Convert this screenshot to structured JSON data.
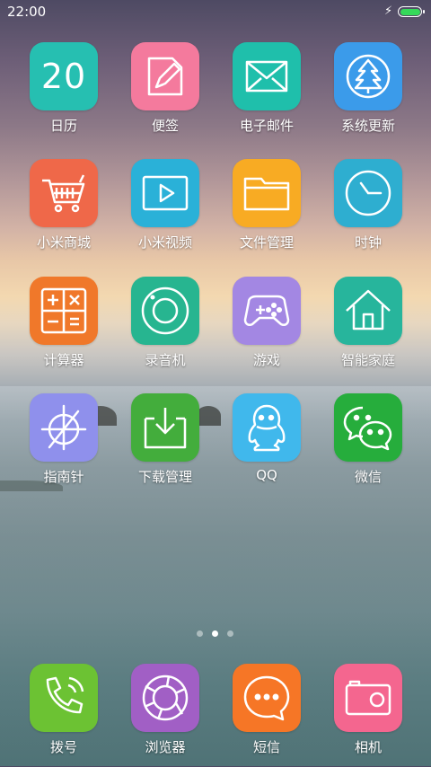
{
  "status": {
    "time": "22:00",
    "battery_level": 1.0,
    "charging": true
  },
  "pages": {
    "count": 3,
    "active": 2
  },
  "apps": [
    {
      "label": "日历",
      "icon": "calendar-icon",
      "color": "#26bfb1",
      "day": "20"
    },
    {
      "label": "便签",
      "icon": "notes-icon",
      "color": "#f47a9d"
    },
    {
      "label": "电子邮件",
      "icon": "mail-icon",
      "color": "#1fbfab"
    },
    {
      "label": "系统更新",
      "icon": "tree-update-icon",
      "color": "#3b9bea"
    },
    {
      "label": "小米商城",
      "icon": "cart-icon",
      "color": "#ef6849"
    },
    {
      "label": "小米视频",
      "icon": "video-play-icon",
      "color": "#2ab1d8"
    },
    {
      "label": "文件管理",
      "icon": "folder-icon",
      "color": "#f8ab23"
    },
    {
      "label": "时钟",
      "icon": "clock-icon",
      "color": "#2eaed0"
    },
    {
      "label": "计算器",
      "icon": "calculator-icon",
      "color": "#f0782a"
    },
    {
      "label": "录音机",
      "icon": "recorder-icon",
      "color": "#27b590"
    },
    {
      "label": "游戏",
      "icon": "gamepad-icon",
      "color": "#a387e3"
    },
    {
      "label": "智能家庭",
      "icon": "home-icon",
      "color": "#27b59c"
    },
    {
      "label": "指南针",
      "icon": "compass-icon",
      "color": "#8f90ec"
    },
    {
      "label": "下载管理",
      "icon": "download-icon",
      "color": "#43ad3c"
    },
    {
      "label": "QQ",
      "icon": "qq-penguin-icon",
      "color": "#40b8ec"
    },
    {
      "label": "微信",
      "icon": "wechat-icon",
      "color": "#26ad3c"
    }
  ],
  "dock": [
    {
      "label": "拨号",
      "icon": "phone-icon",
      "color": "#6cc233"
    },
    {
      "label": "浏览器",
      "icon": "browser-icon",
      "color": "#a15fc5"
    },
    {
      "label": "短信",
      "icon": "message-icon",
      "color": "#f67626"
    },
    {
      "label": "相机",
      "icon": "camera-icon",
      "color": "#f4668f"
    }
  ]
}
